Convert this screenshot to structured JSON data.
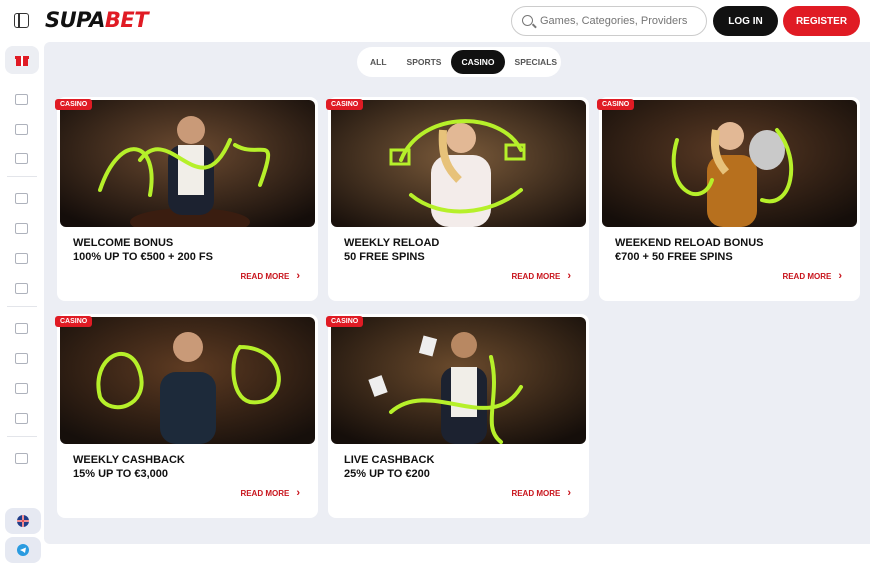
{
  "header": {
    "logo_part1": "SUPA",
    "logo_part2": "BET",
    "search_placeholder": "Games, Categories, Providers",
    "login_label": "LOG IN",
    "register_label": "REGISTER"
  },
  "tabs": [
    "ALL",
    "SPORTS",
    "CASINO",
    "SPECIALS"
  ],
  "active_tab": "CASINO",
  "sidebar": {
    "icons": [
      "gift-icon",
      "poker-chip-icon",
      "slot-machine-icon",
      "live-tv-icon",
      "ticket-icon",
      "document-icon",
      "cards-icon",
      "puzzle-icon",
      "badge-icon",
      "trophy-icon",
      "rocket-icon",
      "briefcase-icon",
      "diamond-icon"
    ],
    "bottom": [
      "uk-flag-icon",
      "telegram-icon"
    ]
  },
  "cards": [
    {
      "badge": "CASINO",
      "line1": "WELCOME BONUS",
      "line2": "100% UP TO €500 + 200 FS",
      "cta": "READ MORE"
    },
    {
      "badge": "CASINO",
      "line1": "WEEKLY RELOAD",
      "line2": "50 FREE SPINS",
      "cta": "READ MORE"
    },
    {
      "badge": "CASINO",
      "line1": "WEEKEND RELOAD BONUS",
      "line2": "€700 + 50 FREE SPINS",
      "cta": "READ MORE"
    },
    {
      "badge": "CASINO",
      "line1": "WEEKLY CASHBACK",
      "line2": "15% UP TO €3,000",
      "cta": "READ MORE"
    },
    {
      "badge": "CASINO",
      "line1": "LIVE CASHBACK",
      "line2": "25% UP TO €200",
      "cta": "READ MORE"
    }
  ],
  "colors": {
    "accent": "#e01b24",
    "lime": "#b6f02a",
    "dark": "#111111"
  }
}
